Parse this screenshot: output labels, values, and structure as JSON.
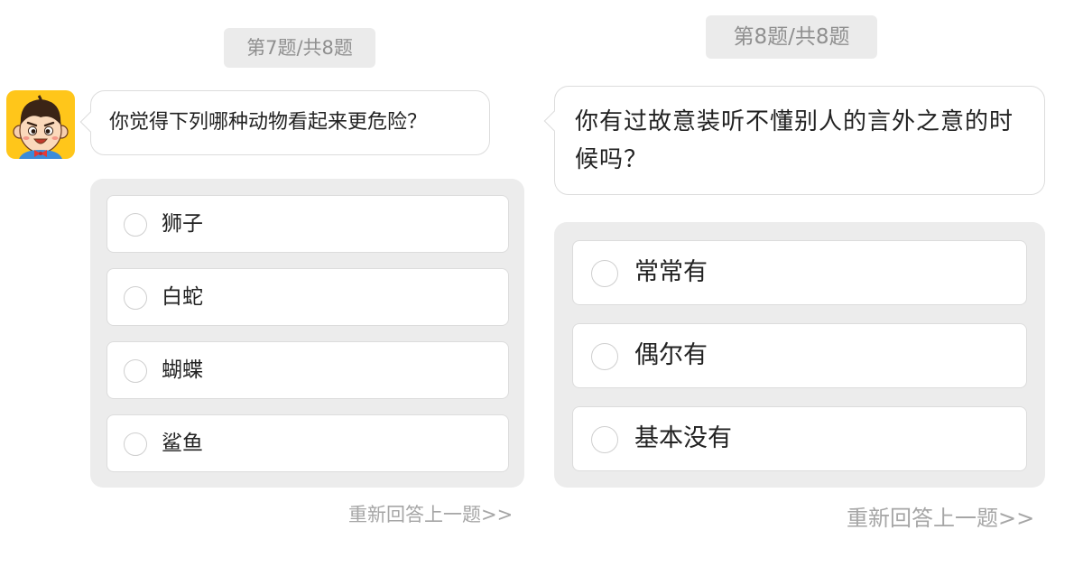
{
  "q7": {
    "counter": "第7题/共8题",
    "question": "你觉得下列哪种动物看起来更危险？",
    "options": [
      "狮子",
      "白蛇",
      "蝴蝶",
      "鲨鱼"
    ],
    "redo_link": "重新回答上一题>>"
  },
  "q8": {
    "counter": "第8题/共8题",
    "question": "你有过故意装听不懂别人的言外之意的时候吗？",
    "options": [
      "常常有",
      "偶尔有",
      "基本没有"
    ],
    "redo_link": "重新回答上一题>>"
  },
  "avatar": {
    "icon": "cartoon-boy-avatar-icon",
    "background": "#ffc61a"
  },
  "colors": {
    "panel": "#ececec",
    "counter_bg": "#ebebeb",
    "muted_text": "#a6a6a6"
  }
}
